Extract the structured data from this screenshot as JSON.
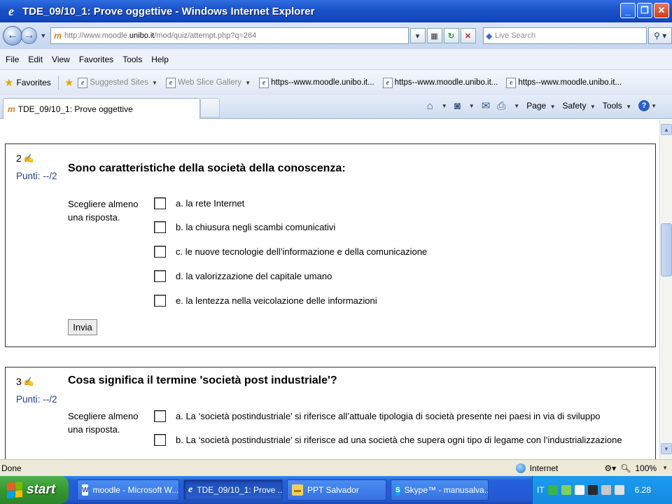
{
  "window": {
    "title": "TDE_09/10_1: Prove oggettive - Windows Internet Explorer"
  },
  "address": {
    "url_prefix": "http://www.moodle.",
    "url_host": "unibo.it",
    "url_path": "/mod/quiz/attempt.php?q=264",
    "search_placeholder": "Live Search"
  },
  "menu": [
    "File",
    "Edit",
    "View",
    "Favorites",
    "Tools",
    "Help"
  ],
  "favorites": {
    "label": "Favorites",
    "items": [
      {
        "label": "Suggested Sites",
        "dropdown": true,
        "gray": true
      },
      {
        "label": "Web Slice Gallery",
        "dropdown": true,
        "gray": true
      },
      {
        "label": "https--www.moodle.unibo.it...",
        "dropdown": false,
        "gray": false
      },
      {
        "label": "https--www.moodle.unibo.it...",
        "dropdown": false,
        "gray": false
      },
      {
        "label": "https--www.moodle.unibo.it...",
        "dropdown": false,
        "gray": false
      }
    ]
  },
  "tab": {
    "label": "TDE_09/10_1: Prove oggettive"
  },
  "commands": {
    "page": "Page",
    "safety": "Safety",
    "tools": "Tools"
  },
  "questions": [
    {
      "number": "2",
      "points": "Punti: --/2",
      "title": "Sono caratteristiche della società della conoscenza:",
      "hint": "Scegliere almeno una risposta.",
      "options": [
        "a. la rete Internet",
        "b. la chiusura negli scambi comunicativi",
        "c. le nuove tecnologie dell’informazione e della comunicazione",
        "d. la valorizzazione del capitale umano",
        "e. la lentezza nella veicolazione delle informazioni"
      ],
      "submit_label": "Invia"
    },
    {
      "number": "3",
      "points": "Punti: --/2",
      "title": "Cosa significa il termine 'società post industriale'?",
      "hint": "Scegliere almeno una risposta.",
      "options": [
        "a. La ‘società postindustriale’ si riferisce all’attuale tipologia di società presente nei paesi in via di sviluppo",
        "b. La ‘società postindustriale’ si riferisce ad una società che supera ogni tipo di legame con l’industrializzazione"
      ]
    }
  ],
  "status": {
    "left": "Done",
    "zone": "Internet",
    "zoom": "100%"
  },
  "taskbar": {
    "start_label": "start",
    "tasks": [
      {
        "label": "moodle - Microsoft W...",
        "active": false
      },
      {
        "label": "TDE_09/10_1: Prove ...",
        "active": true
      },
      {
        "label": "PPT Salvador",
        "active": false
      },
      {
        "label": "Skype™ - manusalva...",
        "active": false
      }
    ],
    "tray_lang": "IT",
    "clock": "6.28"
  }
}
